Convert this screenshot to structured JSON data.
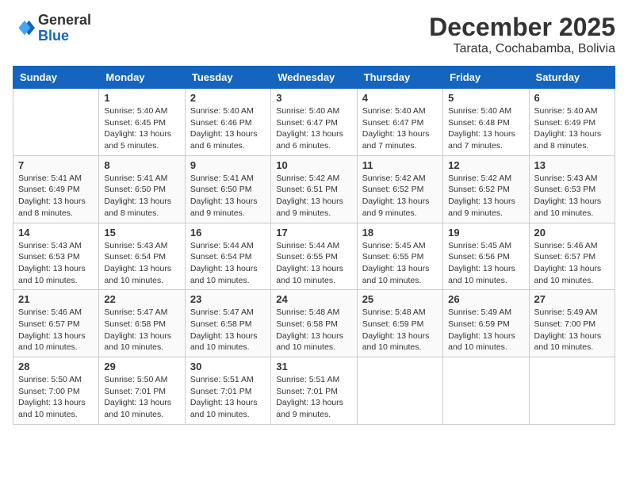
{
  "logo": {
    "general": "General",
    "blue": "Blue"
  },
  "title": {
    "month": "December 2025",
    "location": "Tarata, Cochabamba, Bolivia"
  },
  "headers": [
    "Sunday",
    "Monday",
    "Tuesday",
    "Wednesday",
    "Thursday",
    "Friday",
    "Saturday"
  ],
  "weeks": [
    [
      {
        "day": "",
        "sunrise": "",
        "sunset": "",
        "daylight": ""
      },
      {
        "day": "1",
        "sunrise": "Sunrise: 5:40 AM",
        "sunset": "Sunset: 6:45 PM",
        "daylight": "Daylight: 13 hours and 5 minutes."
      },
      {
        "day": "2",
        "sunrise": "Sunrise: 5:40 AM",
        "sunset": "Sunset: 6:46 PM",
        "daylight": "Daylight: 13 hours and 6 minutes."
      },
      {
        "day": "3",
        "sunrise": "Sunrise: 5:40 AM",
        "sunset": "Sunset: 6:47 PM",
        "daylight": "Daylight: 13 hours and 6 minutes."
      },
      {
        "day": "4",
        "sunrise": "Sunrise: 5:40 AM",
        "sunset": "Sunset: 6:47 PM",
        "daylight": "Daylight: 13 hours and 7 minutes."
      },
      {
        "day": "5",
        "sunrise": "Sunrise: 5:40 AM",
        "sunset": "Sunset: 6:48 PM",
        "daylight": "Daylight: 13 hours and 7 minutes."
      },
      {
        "day": "6",
        "sunrise": "Sunrise: 5:40 AM",
        "sunset": "Sunset: 6:49 PM",
        "daylight": "Daylight: 13 hours and 8 minutes."
      }
    ],
    [
      {
        "day": "7",
        "sunrise": "Sunrise: 5:41 AM",
        "sunset": "Sunset: 6:49 PM",
        "daylight": "Daylight: 13 hours and 8 minutes."
      },
      {
        "day": "8",
        "sunrise": "Sunrise: 5:41 AM",
        "sunset": "Sunset: 6:50 PM",
        "daylight": "Daylight: 13 hours and 8 minutes."
      },
      {
        "day": "9",
        "sunrise": "Sunrise: 5:41 AM",
        "sunset": "Sunset: 6:50 PM",
        "daylight": "Daylight: 13 hours and 9 minutes."
      },
      {
        "day": "10",
        "sunrise": "Sunrise: 5:42 AM",
        "sunset": "Sunset: 6:51 PM",
        "daylight": "Daylight: 13 hours and 9 minutes."
      },
      {
        "day": "11",
        "sunrise": "Sunrise: 5:42 AM",
        "sunset": "Sunset: 6:52 PM",
        "daylight": "Daylight: 13 hours and 9 minutes."
      },
      {
        "day": "12",
        "sunrise": "Sunrise: 5:42 AM",
        "sunset": "Sunset: 6:52 PM",
        "daylight": "Daylight: 13 hours and 9 minutes."
      },
      {
        "day": "13",
        "sunrise": "Sunrise: 5:43 AM",
        "sunset": "Sunset: 6:53 PM",
        "daylight": "Daylight: 13 hours and 10 minutes."
      }
    ],
    [
      {
        "day": "14",
        "sunrise": "Sunrise: 5:43 AM",
        "sunset": "Sunset: 6:53 PM",
        "daylight": "Daylight: 13 hours and 10 minutes."
      },
      {
        "day": "15",
        "sunrise": "Sunrise: 5:43 AM",
        "sunset": "Sunset: 6:54 PM",
        "daylight": "Daylight: 13 hours and 10 minutes."
      },
      {
        "day": "16",
        "sunrise": "Sunrise: 5:44 AM",
        "sunset": "Sunset: 6:54 PM",
        "daylight": "Daylight: 13 hours and 10 minutes."
      },
      {
        "day": "17",
        "sunrise": "Sunrise: 5:44 AM",
        "sunset": "Sunset: 6:55 PM",
        "daylight": "Daylight: 13 hours and 10 minutes."
      },
      {
        "day": "18",
        "sunrise": "Sunrise: 5:45 AM",
        "sunset": "Sunset: 6:55 PM",
        "daylight": "Daylight: 13 hours and 10 minutes."
      },
      {
        "day": "19",
        "sunrise": "Sunrise: 5:45 AM",
        "sunset": "Sunset: 6:56 PM",
        "daylight": "Daylight: 13 hours and 10 minutes."
      },
      {
        "day": "20",
        "sunrise": "Sunrise: 5:46 AM",
        "sunset": "Sunset: 6:57 PM",
        "daylight": "Daylight: 13 hours and 10 minutes."
      }
    ],
    [
      {
        "day": "21",
        "sunrise": "Sunrise: 5:46 AM",
        "sunset": "Sunset: 6:57 PM",
        "daylight": "Daylight: 13 hours and 10 minutes."
      },
      {
        "day": "22",
        "sunrise": "Sunrise: 5:47 AM",
        "sunset": "Sunset: 6:58 PM",
        "daylight": "Daylight: 13 hours and 10 minutes."
      },
      {
        "day": "23",
        "sunrise": "Sunrise: 5:47 AM",
        "sunset": "Sunset: 6:58 PM",
        "daylight": "Daylight: 13 hours and 10 minutes."
      },
      {
        "day": "24",
        "sunrise": "Sunrise: 5:48 AM",
        "sunset": "Sunset: 6:58 PM",
        "daylight": "Daylight: 13 hours and 10 minutes."
      },
      {
        "day": "25",
        "sunrise": "Sunrise: 5:48 AM",
        "sunset": "Sunset: 6:59 PM",
        "daylight": "Daylight: 13 hours and 10 minutes."
      },
      {
        "day": "26",
        "sunrise": "Sunrise: 5:49 AM",
        "sunset": "Sunset: 6:59 PM",
        "daylight": "Daylight: 13 hours and 10 minutes."
      },
      {
        "day": "27",
        "sunrise": "Sunrise: 5:49 AM",
        "sunset": "Sunset: 7:00 PM",
        "daylight": "Daylight: 13 hours and 10 minutes."
      }
    ],
    [
      {
        "day": "28",
        "sunrise": "Sunrise: 5:50 AM",
        "sunset": "Sunset: 7:00 PM",
        "daylight": "Daylight: 13 hours and 10 minutes."
      },
      {
        "day": "29",
        "sunrise": "Sunrise: 5:50 AM",
        "sunset": "Sunset: 7:01 PM",
        "daylight": "Daylight: 13 hours and 10 minutes."
      },
      {
        "day": "30",
        "sunrise": "Sunrise: 5:51 AM",
        "sunset": "Sunset: 7:01 PM",
        "daylight": "Daylight: 13 hours and 10 minutes."
      },
      {
        "day": "31",
        "sunrise": "Sunrise: 5:51 AM",
        "sunset": "Sunset: 7:01 PM",
        "daylight": "Daylight: 13 hours and 9 minutes."
      },
      {
        "day": "",
        "sunrise": "",
        "sunset": "",
        "daylight": ""
      },
      {
        "day": "",
        "sunrise": "",
        "sunset": "",
        "daylight": ""
      },
      {
        "day": "",
        "sunrise": "",
        "sunset": "",
        "daylight": ""
      }
    ]
  ]
}
